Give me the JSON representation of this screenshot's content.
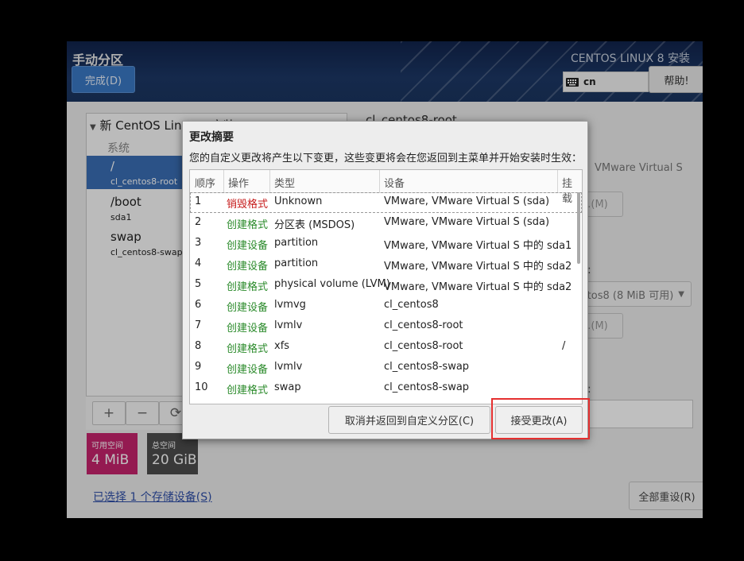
{
  "header": {
    "title": "手动分区",
    "done_label": "完成(D)",
    "product": "CENTOS LINUX 8 安装",
    "keyboard": "cn",
    "help_label": "帮助!"
  },
  "left": {
    "tree_header": "新 CentOS Linux 8 安装",
    "section": "系统",
    "mounts": [
      {
        "name": "/",
        "device": "cl_centos8-root"
      },
      {
        "name": "/boot",
        "device": "sda1"
      },
      {
        "name": "swap",
        "device": "cl_centos8-swap"
      }
    ],
    "toolbar": {
      "add": "+",
      "remove": "−",
      "refresh": "⟳"
    },
    "available": {
      "label": "可用空间",
      "value": "4 MiB"
    },
    "total": {
      "label": "总空间",
      "value": "20 GiB"
    },
    "devices_link": "已选择 1 个存储设备(S)"
  },
  "right": {
    "title": "cl_centos8-root",
    "device_text": "VMware Virtual S",
    "modify1": "...(M)",
    "modify2": "...(M)",
    "label1": ":",
    "label2": ":",
    "vg_value": "tos8  (8 MiB 可用)",
    "reset_all": "全部重设(R)"
  },
  "dialog": {
    "title": "更改摘要",
    "description": "您的自定义更改将产生以下变更，这些变更将会在您返回到主菜单并开始安装时生效：",
    "columns": [
      "顺序",
      "操作",
      "类型",
      "设备",
      "挂载"
    ],
    "rows": [
      {
        "order": "1",
        "action": "销毁格式",
        "action_color": "red",
        "type": "Unknown",
        "device": "VMware, VMware Virtual S (sda)",
        "mount": ""
      },
      {
        "order": "2",
        "action": "创建格式",
        "action_color": "green",
        "type": "分区表 (MSDOS)",
        "device": "VMware, VMware Virtual S (sda)",
        "mount": ""
      },
      {
        "order": "3",
        "action": "创建设备",
        "action_color": "green",
        "type": "partition",
        "device": "VMware, VMware Virtual S 中的 sda1",
        "mount": ""
      },
      {
        "order": "4",
        "action": "创建设备",
        "action_color": "green",
        "type": "partition",
        "device": "VMware, VMware Virtual S 中的 sda2",
        "mount": ""
      },
      {
        "order": "5",
        "action": "创建格式",
        "action_color": "green",
        "type": "physical volume (LVM)",
        "device": "VMware, VMware Virtual S 中的 sda2",
        "mount": ""
      },
      {
        "order": "6",
        "action": "创建设备",
        "action_color": "green",
        "type": "lvmvg",
        "device": "cl_centos8",
        "mount": ""
      },
      {
        "order": "7",
        "action": "创建设备",
        "action_color": "green",
        "type": "lvmlv",
        "device": "cl_centos8-root",
        "mount": ""
      },
      {
        "order": "8",
        "action": "创建格式",
        "action_color": "green",
        "type": "xfs",
        "device": "cl_centos8-root",
        "mount": "/"
      },
      {
        "order": "9",
        "action": "创建设备",
        "action_color": "green",
        "type": "lvmlv",
        "device": "cl_centos8-swap",
        "mount": ""
      },
      {
        "order": "10",
        "action": "创建格式",
        "action_color": "green",
        "type": "swap",
        "device": "cl_centos8-swap",
        "mount": ""
      }
    ],
    "cancel_label": "取消并返回到自定义分区(C)",
    "accept_label": "接受更改(A)"
  }
}
